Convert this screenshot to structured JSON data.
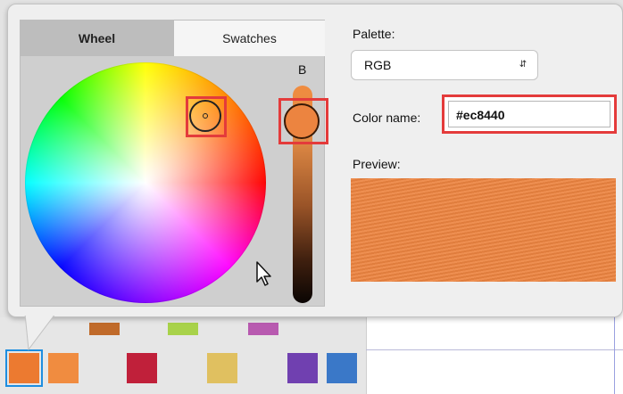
{
  "tabs": [
    {
      "label": "Wheel"
    },
    {
      "label": "Swatches"
    }
  ],
  "brightness": {
    "label": "B"
  },
  "palette": {
    "label": "Palette:",
    "value": "RGB"
  },
  "color_name": {
    "label": "Color name:",
    "value": "#ec8440"
  },
  "preview": {
    "label": "Preview:",
    "color": "#ec8440"
  },
  "selection": {
    "color": "#ec8440",
    "highlight_color": "#e43b3b"
  },
  "swatches": {
    "top_row": [
      "#c06a2a",
      "#a8d24a",
      "#b85ab0"
    ],
    "bottom_row": [
      "#ec7a30",
      "#f08c40",
      "#c0203a",
      "#e0c060",
      "#7040b0",
      "#3a78c8"
    ],
    "selected_index": 0
  }
}
